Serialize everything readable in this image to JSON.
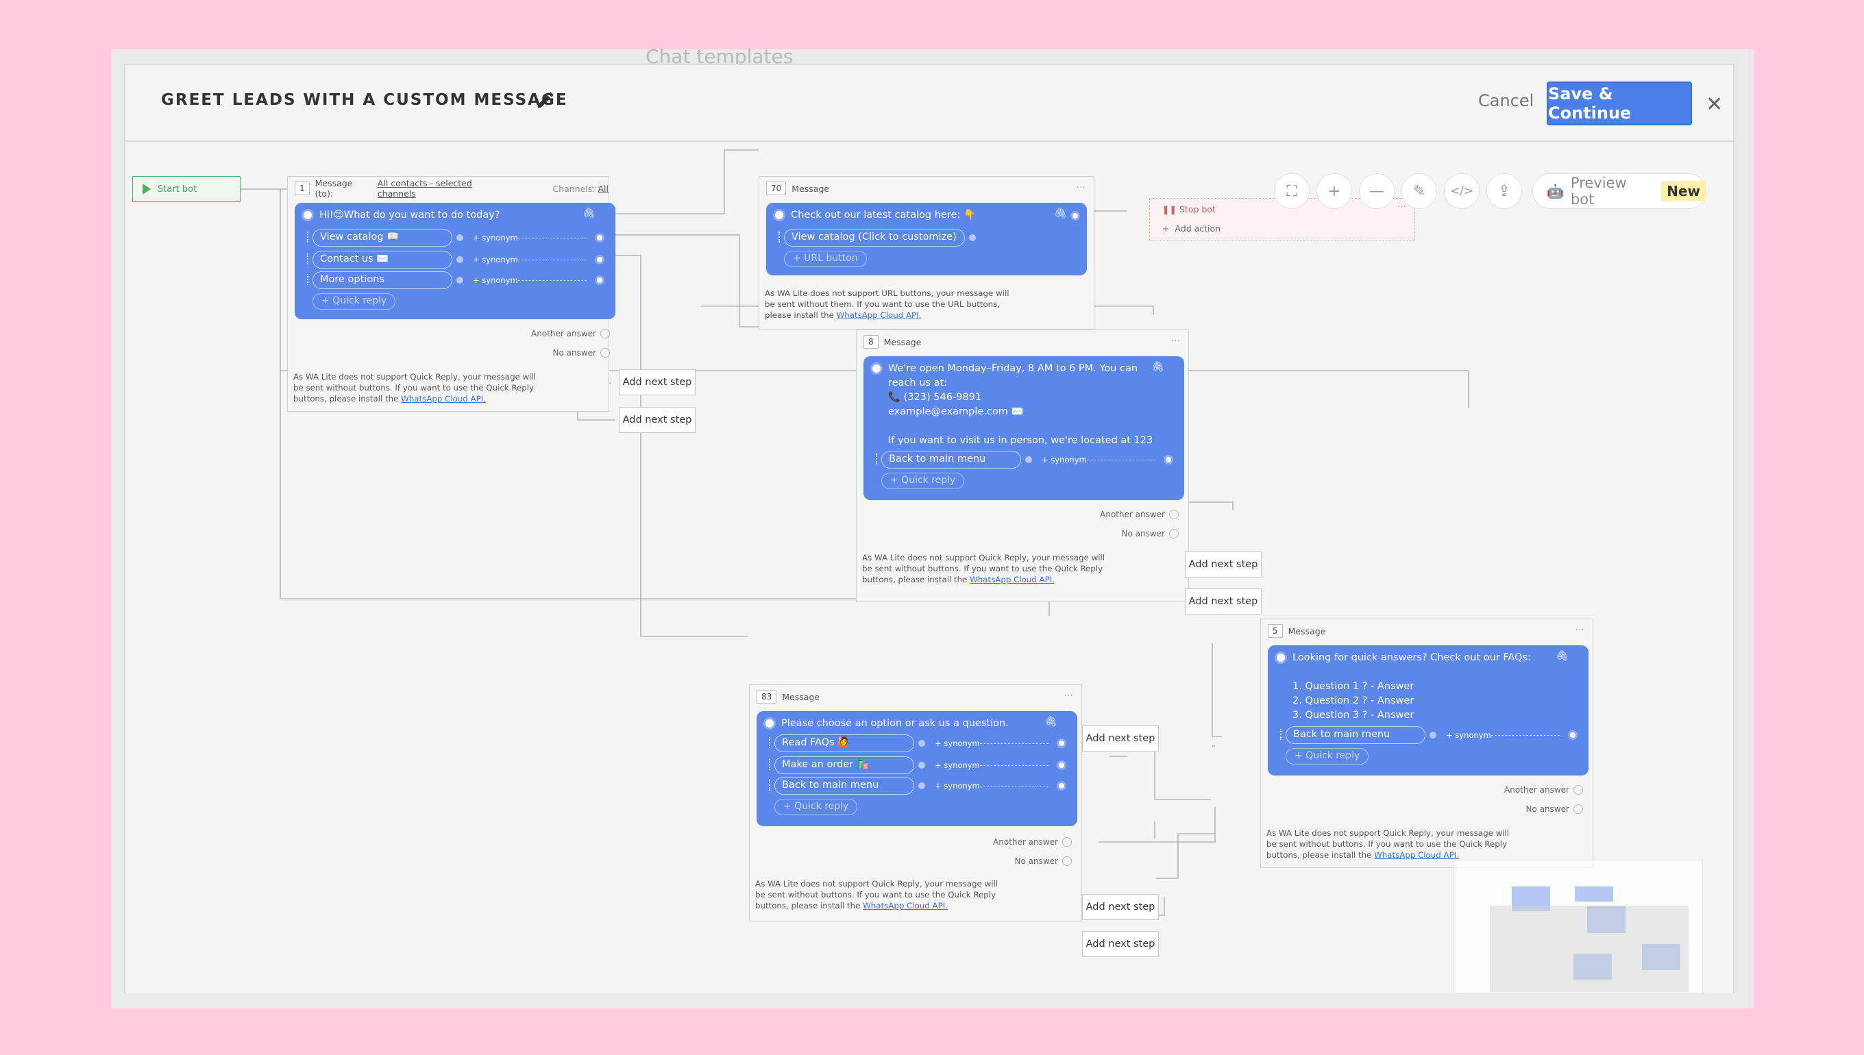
{
  "page": {
    "background_ghost_text": "Chat templates"
  },
  "header": {
    "title": "GREET LEADS WITH A CUSTOM MESSAGE",
    "cancel_label": "Cancel",
    "save_label": "Save & Continue"
  },
  "toolbar": {
    "icons": [
      "fullscreen-icon",
      "zoom-in-icon",
      "zoom-out-icon",
      "magic-wand-icon",
      "code-icon",
      "export-icon"
    ],
    "preview_label": "Preview bot",
    "preview_badge": "New"
  },
  "start": {
    "label": "Start bot"
  },
  "stop": {
    "label": "Stop bot",
    "add_action": "Add action"
  },
  "common": {
    "synonym": "+ synonym",
    "quick_reply": "+ Quick reply",
    "url_button": "+ URL button",
    "another_answer": "Another answer",
    "no_answer": "No answer",
    "add_next_step": "Add next step",
    "link_text": "WhatsApp Cloud API."
  },
  "node1": {
    "num": "1",
    "head_label": "Message (to):",
    "recipients": "All contacts - selected channels",
    "channels_label": "Channels:",
    "channels_value": "All",
    "text": "Hi!😊What do you want to do today?",
    "buttons": [
      "View catalog 📖",
      "Contact us ✉️",
      "More options"
    ],
    "note": "As WA Lite does not support Quick Reply, your message will be sent without buttons. If you want to use the Quick Reply buttons, please install the"
  },
  "node70": {
    "num": "70",
    "head_label": "Message",
    "text": "Check out our latest catalog here: 👇",
    "buttons": [
      "View catalog  (Click to customize)"
    ],
    "note": "As WA Lite does not support URL buttons, your message will be sent without them. If you want to use the URL buttons, please install the"
  },
  "node8": {
    "num": "8",
    "head_label": "Message",
    "lines": [
      "We're open Monday–Friday, 8 AM to 6 PM. You can",
      "reach us at:",
      "📞 (323) 546-9891",
      "example@example.com ✉️",
      "",
      "If you want to visit us in person, we're located at 123"
    ],
    "buttons": [
      "Back to main menu"
    ],
    "note": "As WA Lite does not support Quick Reply, your message will be sent without buttons. If you want to use the Quick Reply buttons, please install the"
  },
  "node83": {
    "num": "83",
    "head_label": "Message",
    "text": "Please choose an option or ask us a question.",
    "buttons": [
      "Read FAQs 🙋",
      "Make an order 🛍️",
      "Back to main menu"
    ],
    "note": "As WA Lite does not support Quick Reply, your message will be sent without buttons. If you want to use the Quick Reply buttons, please install the"
  },
  "node5": {
    "num": "5",
    "head_label": "Message",
    "lines": [
      "Looking for quick answers? Check out our FAQs:",
      "",
      "1. Question 1 ? - Answer",
      "2. Question 2 ? - Answer",
      "3. Question 3 ? - Answer"
    ],
    "buttons": [
      "Back to main menu"
    ],
    "note": "As WA Lite does not support Quick Reply, your message will be sent without buttons. If you want to use the Quick Reply buttons, please install the"
  },
  "colors": {
    "accent": "#4a7ee8",
    "card": "#5b87ea",
    "start": "#4fae60",
    "stop": "#d46060",
    "badge": "#fff2a8",
    "background": "#ffc8dd"
  }
}
